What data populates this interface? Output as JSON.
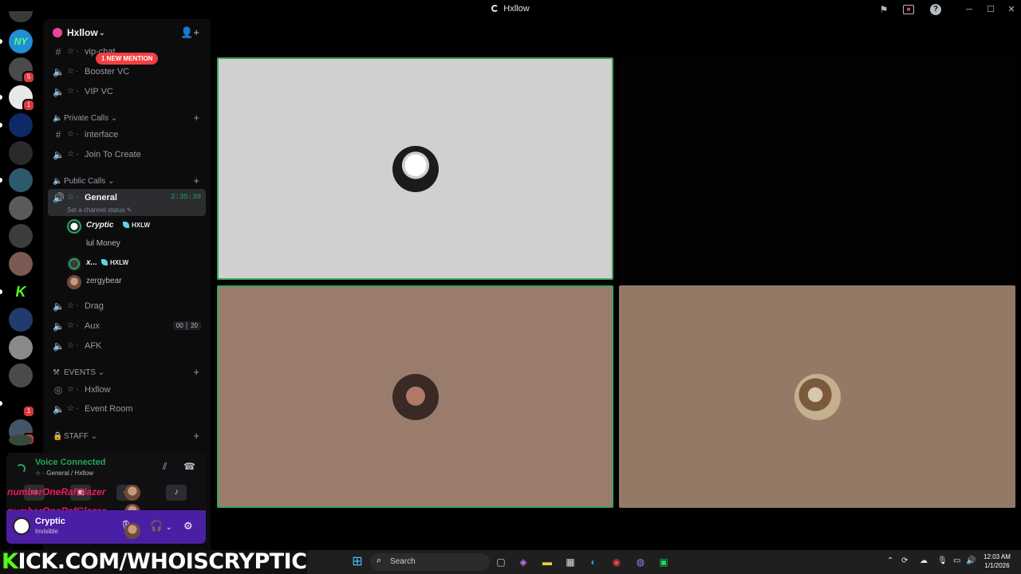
{
  "window": {
    "title": "Hxllow"
  },
  "server": {
    "name": "Hxllow",
    "mention_badge": "1 NEW MENTION"
  },
  "rail": {
    "servers": [
      {
        "name": "server-ny",
        "label": "NY",
        "color": "#1d8fd6",
        "badge": ""
      },
      {
        "name": "server-2",
        "label": "",
        "color": "#4a4a4a",
        "badge": "5"
      },
      {
        "name": "server-3",
        "label": "",
        "color": "#e8e8e8",
        "badge": "1"
      },
      {
        "name": "server-4",
        "label": "",
        "color": "#0d2a66",
        "badge": ""
      },
      {
        "name": "server-5",
        "label": "",
        "color": "#2a2a2a",
        "badge": ""
      },
      {
        "name": "server-6",
        "label": "",
        "color": "#2d5a6b",
        "badge": ""
      },
      {
        "name": "server-7",
        "label": "",
        "color": "#5a5a5a",
        "badge": ""
      },
      {
        "name": "server-8",
        "label": "",
        "color": "#3c3c3c",
        "badge": ""
      },
      {
        "name": "server-9",
        "label": "",
        "color": "#7a5a52",
        "badge": ""
      },
      {
        "name": "server-kick",
        "label": "K",
        "color": "#000000",
        "badge": ""
      },
      {
        "name": "server-11",
        "label": "",
        "color": "#233a6e",
        "badge": ""
      },
      {
        "name": "server-12",
        "label": "",
        "color": "#8a8a8a",
        "badge": ""
      },
      {
        "name": "server-13",
        "label": "",
        "color": "#4a4a4a",
        "badge": ""
      },
      {
        "name": "server-hxllow",
        "label": "",
        "color": "#000000",
        "badge": "1"
      },
      {
        "name": "server-15",
        "label": "",
        "color": "#445566",
        "badge": "1"
      },
      {
        "name": "server-16",
        "label": "",
        "color": "#3a4a3a",
        "badge": ""
      }
    ]
  },
  "channels": {
    "vip_chat": "vip-chat",
    "booster_vc": "Booster VC",
    "vip_vc": "VIP VC",
    "cat_private": "Private Calls",
    "interface": "interface",
    "join_create": "Join To Create",
    "cat_public": "Public Calls",
    "general": "General",
    "general_timer": "2:35:39",
    "general_status": "Set a channel status",
    "drag": "Drag",
    "aux": "Aux",
    "aux_limit": "00 │ 20",
    "afk": "AFK",
    "cat_events": "EVENTS",
    "hxllow_stage": "Hxllow",
    "event_room": "Event Room",
    "cat_staff": "STAFF"
  },
  "voice_users": [
    {
      "name": "Cryptic",
      "tag": "HXLW",
      "bold": true
    },
    {
      "name": "lul Money",
      "tag": "",
      "bold": false
    },
    {
      "name": "x...",
      "tag": "HXLW",
      "bold": true
    },
    {
      "name": "zergybear",
      "tag": "",
      "bold": false
    }
  ],
  "voice_panel": {
    "status": "Voice Connected",
    "location": "☆ · General / Hxllow"
  },
  "user_panel": {
    "username": "Cryptic",
    "status": "Invisible"
  },
  "overlay": {
    "lines": [
      "numberOneRafGlazer",
      "numberOneRafGlazer",
      "numberOneRafGlazer"
    ]
  },
  "stream_banner": {
    "prefix": "K",
    "text": "ICK.COM/WHOISCRYPTIC"
  },
  "taskbar": {
    "search_placeholder": "Search",
    "time": "12:03 AM",
    "date": "1/1/2026"
  },
  "colors": {
    "accent_green": "#23a55a",
    "mention_red": "#f23f43",
    "user_panel_purple": "#4b1fa3",
    "tile_highlight": "#3ba55c"
  }
}
